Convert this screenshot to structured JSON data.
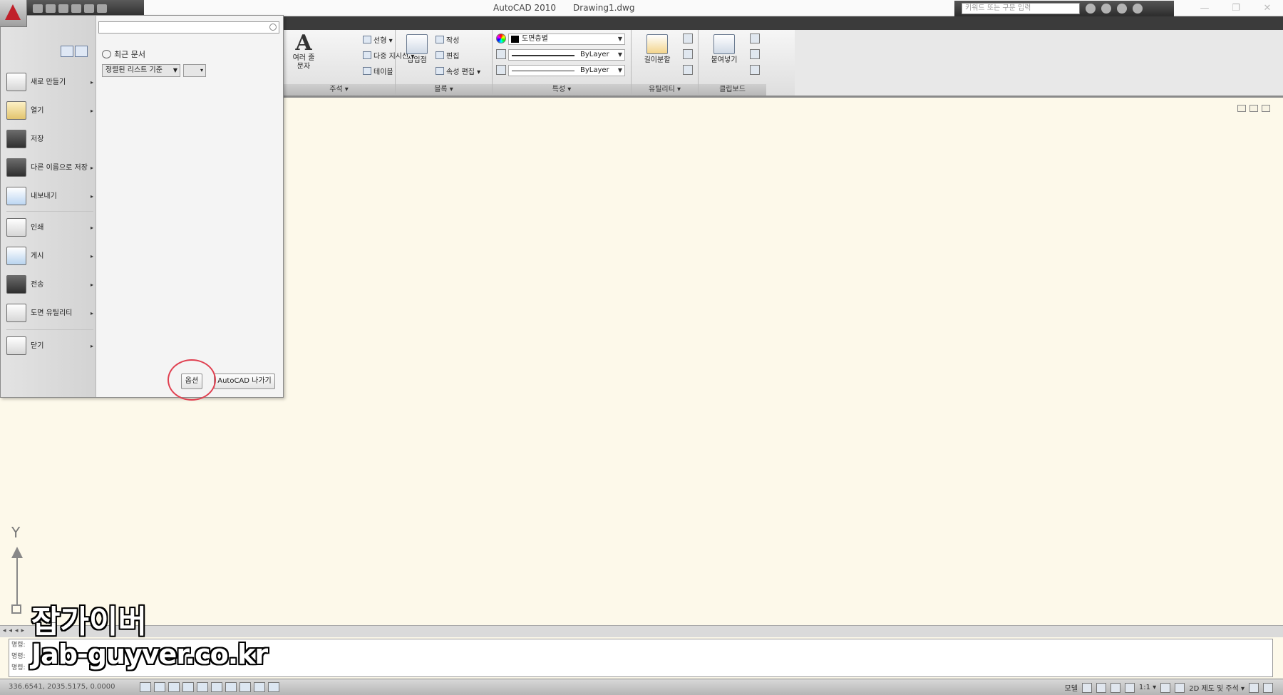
{
  "titlebar": {
    "app_name": "AutoCAD 2010",
    "doc_name": "Drawing1.dwg",
    "search_placeholder": "키워드 또는 구문 입력",
    "minimize": "—",
    "restore": "❐",
    "close": "✕"
  },
  "ribbon": {
    "annotation": {
      "title": "주석 ▾",
      "multiline_text_line1": "여러 줄",
      "multiline_text_line2": "문자",
      "linear": "선형 ▾",
      "multileader": "다중 지시선 ▾",
      "table": "테이블"
    },
    "block": {
      "title": "블록 ▾",
      "insert": "삽입점",
      "create": "작성",
      "edit": "편집",
      "edit_attributes": "속성 편집 ▾"
    },
    "properties": {
      "title": "특성 ▾",
      "color": "도면층별",
      "linetype": "ByLayer",
      "lineweight": "ByLayer"
    },
    "utilities": {
      "title": "유틸리티 ▾",
      "measure": "길이분할"
    },
    "clipboard": {
      "title": "클립보드",
      "paste": "붙여넣기"
    }
  },
  "app_menu": {
    "search_placeholder": "",
    "recent_docs_title": "최근 문서",
    "sort_option": "정렬된 리스트 기준",
    "view_option": "▾",
    "items": [
      {
        "label": "새로 만들기",
        "arrow": "▸"
      },
      {
        "label": "열기",
        "arrow": "▸"
      },
      {
        "label": "저장",
        "arrow": ""
      },
      {
        "label": "다른 이름으로 저장",
        "arrow": "▸"
      },
      {
        "label": "내보내기",
        "arrow": "▸"
      },
      {
        "label": "인쇄",
        "arrow": "▸"
      },
      {
        "label": "게시",
        "arrow": "▸"
      },
      {
        "label": "전송",
        "arrow": "▸"
      },
      {
        "label": "도면 유틸리티",
        "arrow": "▸"
      },
      {
        "label": "닫기",
        "arrow": "▸"
      }
    ],
    "options_button": "옵션",
    "exit_button": "AutoCAD 나가기"
  },
  "drawing": {
    "ucs_y_label": "Y"
  },
  "command": {
    "lines": [
      "명령:",
      "명령:",
      "명령:"
    ]
  },
  "status": {
    "coordinates": "336.6541, 2035.5175, 0.0000",
    "model": "모델",
    "scale": "1:1 ▾",
    "workspace": "2D 제도 및 주석 ▾"
  },
  "watermark": {
    "line1": "잡가이버",
    "line2": "Jab-guyver.co.kr"
  },
  "colors": {
    "canvas": "#fdf9ea",
    "titlebar_dark": "#3b3b3b",
    "highlight": "#e04050"
  }
}
